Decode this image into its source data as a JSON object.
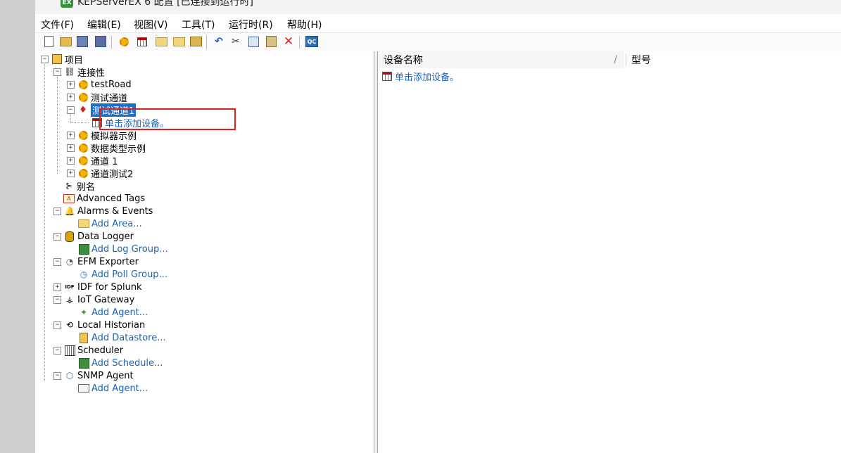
{
  "window": {
    "title": "KEPServerEX 6 配置 [已连接到运行时]"
  },
  "menu": [
    "文件(F)",
    "编辑(E)",
    "视图(V)",
    "工具(T)",
    "运行时(R)",
    "帮助(H)"
  ],
  "toolbar": {
    "buttons": [
      "new-icon",
      "open-icon",
      "save-icon",
      "save-as-icon",
      "new-channel-icon",
      "new-device-icon",
      "new-tag-group-icon",
      "new-tag-icon",
      "properties-icon",
      "undo-icon",
      "cut-icon",
      "copy-icon",
      "paste-icon",
      "delete-icon",
      "quick-client-icon"
    ],
    "quick_client_label": "QC"
  },
  "tree": {
    "root": "项目",
    "connectivity": "连接性",
    "channels": [
      "testRoad",
      "测试通道",
      "测试通道1",
      "模拟器示例",
      "数据类型示例",
      "通道 1",
      "通道测试2"
    ],
    "add_device": "单击添加设备。",
    "aliases": "别名",
    "advanced_tags": "Advanced Tags",
    "alarms": "Alarms & Events",
    "add_area": "Add Area...",
    "data_logger": "Data Logger",
    "add_log_group": "Add Log Group...",
    "efm": "EFM Exporter",
    "add_poll_group": "Add Poll Group...",
    "idf": "IDF for Splunk",
    "iot": "IoT Gateway",
    "add_agent": "Add Agent...",
    "historian": "Local Historian",
    "add_datastore": "Add Datastore...",
    "scheduler": "Scheduler",
    "add_schedule": "Add Schedule...",
    "snmp": "SNMP Agent",
    "add_agent2": "Add Agent...",
    "idf_icon_text": "IDF",
    "adv_icon_text": "A"
  },
  "list": {
    "columns": [
      "设备名称",
      "型号"
    ],
    "add_device": "单击添加设备。"
  },
  "colors": {
    "selection": "#1c6fc9",
    "link": "#1a63b6",
    "highlight": "#e02020"
  }
}
